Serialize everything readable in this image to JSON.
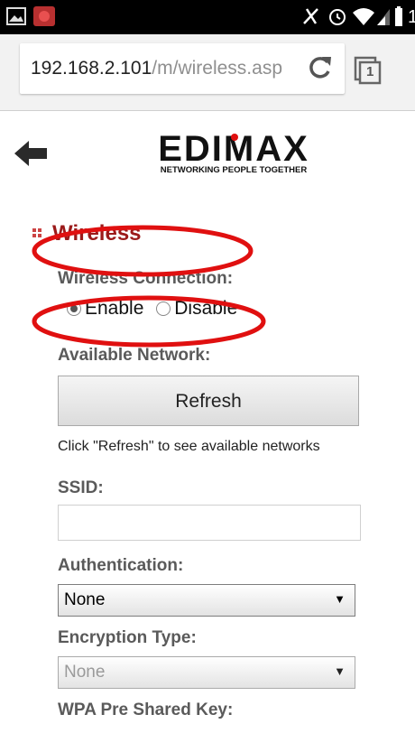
{
  "browser": {
    "url_host": "192.168.2.101",
    "url_path": "/m/wireless.asp",
    "tab_count": "1"
  },
  "status_bar": {
    "icons": [
      "image-notification-icon",
      "app-notification-icon",
      "mute-icon",
      "alarm-icon",
      "wifi-icon",
      "signal-icon",
      "battery-icon"
    ],
    "clock_fragment": "1"
  },
  "logo": {
    "brand": "EDIMAX",
    "tagline": "NETWORKING PEOPLE TOGETHER"
  },
  "section": {
    "title": "Wireless"
  },
  "form": {
    "connection_label": "Wireless Connection:",
    "enable_label": "Enable",
    "disable_label": "Disable",
    "connection_value": "Enable",
    "available_label": "Available Network:",
    "refresh_label": "Refresh",
    "refresh_hint": "Click \"Refresh\" to see available networks",
    "ssid_label": "SSID:",
    "ssid_value": "",
    "auth_label": "Authentication:",
    "auth_value": "None",
    "enc_label": "Encryption Type:",
    "enc_value": "None",
    "wpa_label": "WPA Pre Shared Key:"
  },
  "colors": {
    "accent_red": "#9b1a1a",
    "annotation_red": "#e01010",
    "label_gray": "#5a5a5a"
  }
}
